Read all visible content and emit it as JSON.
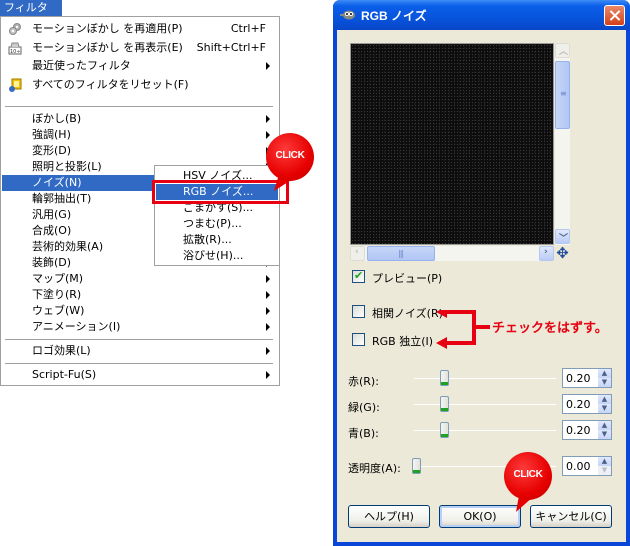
{
  "menubar": {
    "filters_label": "フィルタ(R)"
  },
  "filters_menu": {
    "items": [
      {
        "label": "モーションぼかし を再適用(P)",
        "accel": "Ctrl+F",
        "icon": "gear-icon"
      },
      {
        "label": "モーションぼかし を再表示(E)",
        "accel": "Shift+Ctrl+F",
        "icon": "dialog-icon"
      },
      {
        "label": "最近使ったフィルタ",
        "submenu": true
      },
      {
        "label": "すべてのフィルタをリセット(F)",
        "icon": "reset-icon"
      },
      {
        "label": "ぼかし(B)",
        "submenu": true
      },
      {
        "label": "強調(H)",
        "submenu": true
      },
      {
        "label": "変形(D)",
        "submenu": true
      },
      {
        "label": "照明と投影(L)",
        "submenu": true
      },
      {
        "label": "ノイズ(N)",
        "submenu": true,
        "highlighted": true
      },
      {
        "label": "輪郭抽出(T)",
        "submenu": true
      },
      {
        "label": "汎用(G)",
        "submenu": true
      },
      {
        "label": "合成(O)",
        "submenu": true
      },
      {
        "label": "芸術的効果(A)",
        "submenu": true
      },
      {
        "label": "装飾(D)",
        "submenu": true
      },
      {
        "label": "マップ(M)",
        "submenu": true
      },
      {
        "label": "下塗り(R)",
        "submenu": true
      },
      {
        "label": "ウェブ(W)",
        "submenu": true
      },
      {
        "label": "アニメーション(I)",
        "submenu": true
      },
      {
        "label": "ロゴ効果(L)",
        "submenu": true
      },
      {
        "label": "Script-Fu(S)",
        "submenu": true
      }
    ]
  },
  "noise_submenu": {
    "items": [
      {
        "label": "HSV ノイズ..."
      },
      {
        "label": "RGB ノイズ...",
        "highlighted": true
      },
      {
        "label": "ごまかす(S)..."
      },
      {
        "label": "つまむ(P)..."
      },
      {
        "label": "拡散(R)..."
      },
      {
        "label": "浴びせ(H)..."
      }
    ]
  },
  "callouts": {
    "click_label": "CLICK"
  },
  "dialog": {
    "title": "RGB ノイズ",
    "preview_label": "プレビュー(P)",
    "preview_checked": true,
    "correlated_noise_label": "相関ノイズ(R)",
    "correlated_noise_checked": false,
    "independent_rgb_label": "RGB 独立(I)",
    "independent_rgb_checked": false,
    "annotation": "チェックをはずす。",
    "sliders": [
      {
        "label": "赤(R):",
        "value": "0.20",
        "fraction": 0.2
      },
      {
        "label": "緑(G):",
        "value": "0.20",
        "fraction": 0.2
      },
      {
        "label": "青(B):",
        "value": "0.20",
        "fraction": 0.2
      },
      {
        "label": "透明度(A):",
        "value": "0.00",
        "fraction": 0.0
      }
    ],
    "buttons": {
      "help": "ヘルプ(H)",
      "ok": "OK(O)",
      "cancel": "キャンセル(C)"
    }
  },
  "colors": {
    "highlight": "#316ac5",
    "annotation_red": "#e60012",
    "title_blue": "#0a5ee8"
  }
}
